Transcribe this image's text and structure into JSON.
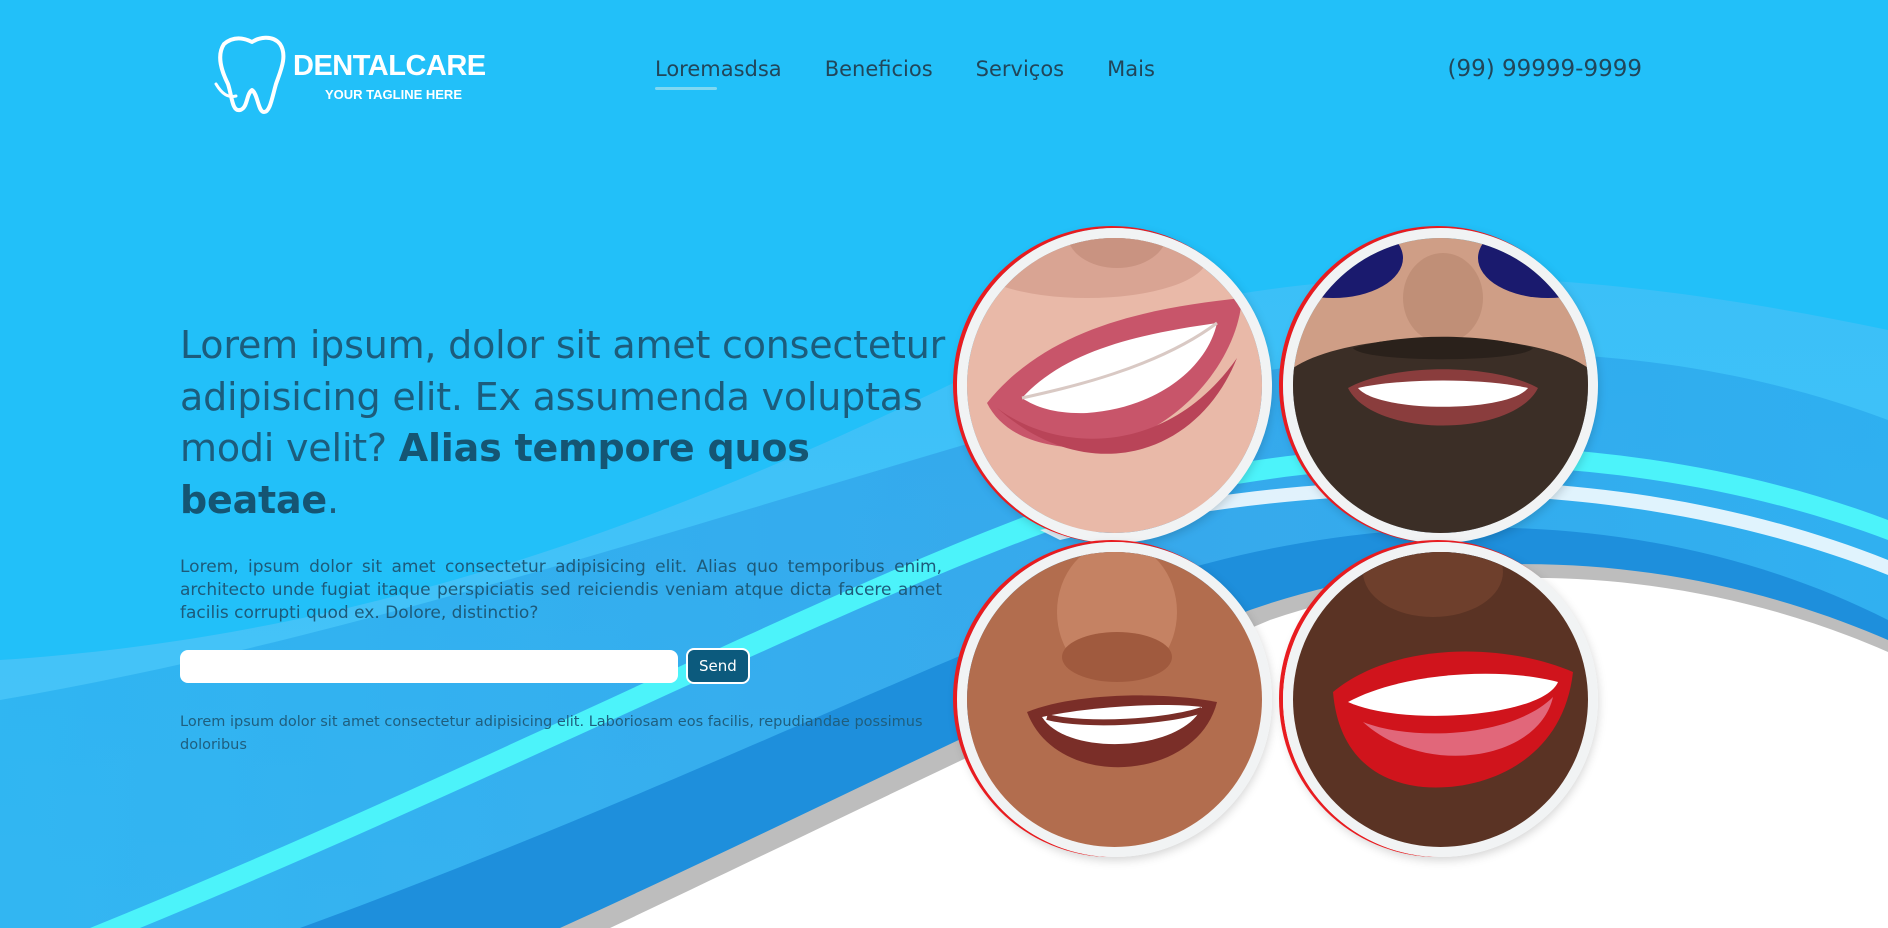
{
  "brand": {
    "name": "DENTALCARE",
    "tagline": "YOUR TAGLINE HERE",
    "icon": "tooth-icon"
  },
  "nav": {
    "items": [
      "Loremasdsa",
      "Beneficios",
      "Serviços",
      "Mais"
    ],
    "active_index": 0
  },
  "contact": {
    "phone": "(99) 99999-9999"
  },
  "hero": {
    "headline_regular": "Lorem ipsum, dolor sit amet consectetur adipisicing elit. Ex assumenda voluptas modi velit? ",
    "headline_bold": "Alias tempore quos beatae",
    "headline_end": ".",
    "paragraph": "Lorem, ipsum dolor sit amet consectetur adipisicing elit. Alias quo temporibus enim, architecto unde fugiat itaque perspiciatis sed reiciendis veniam atque dicta facere amet facilis corrupti quod ex. Dolore, distinctio?",
    "email_value": "",
    "send_label": "Send",
    "note": "Lorem ipsum dolor sit amet consectetur adipisicing elit. Laboriosam eos facilis, repudiandae possimus doloribus"
  },
  "gallery": {
    "photos": [
      "smile-photo-woman-pink-lips",
      "smile-photo-man-beard-sunglasses",
      "smile-photo-child",
      "smile-photo-woman-red-lips"
    ]
  },
  "colors": {
    "background": "#22c0f9",
    "accent_dark": "#0c5a7d",
    "text": "#1c5c7c",
    "nav_text": "#21465a",
    "wave_cyan": "#4cf3fa",
    "white": "#ffffff"
  }
}
